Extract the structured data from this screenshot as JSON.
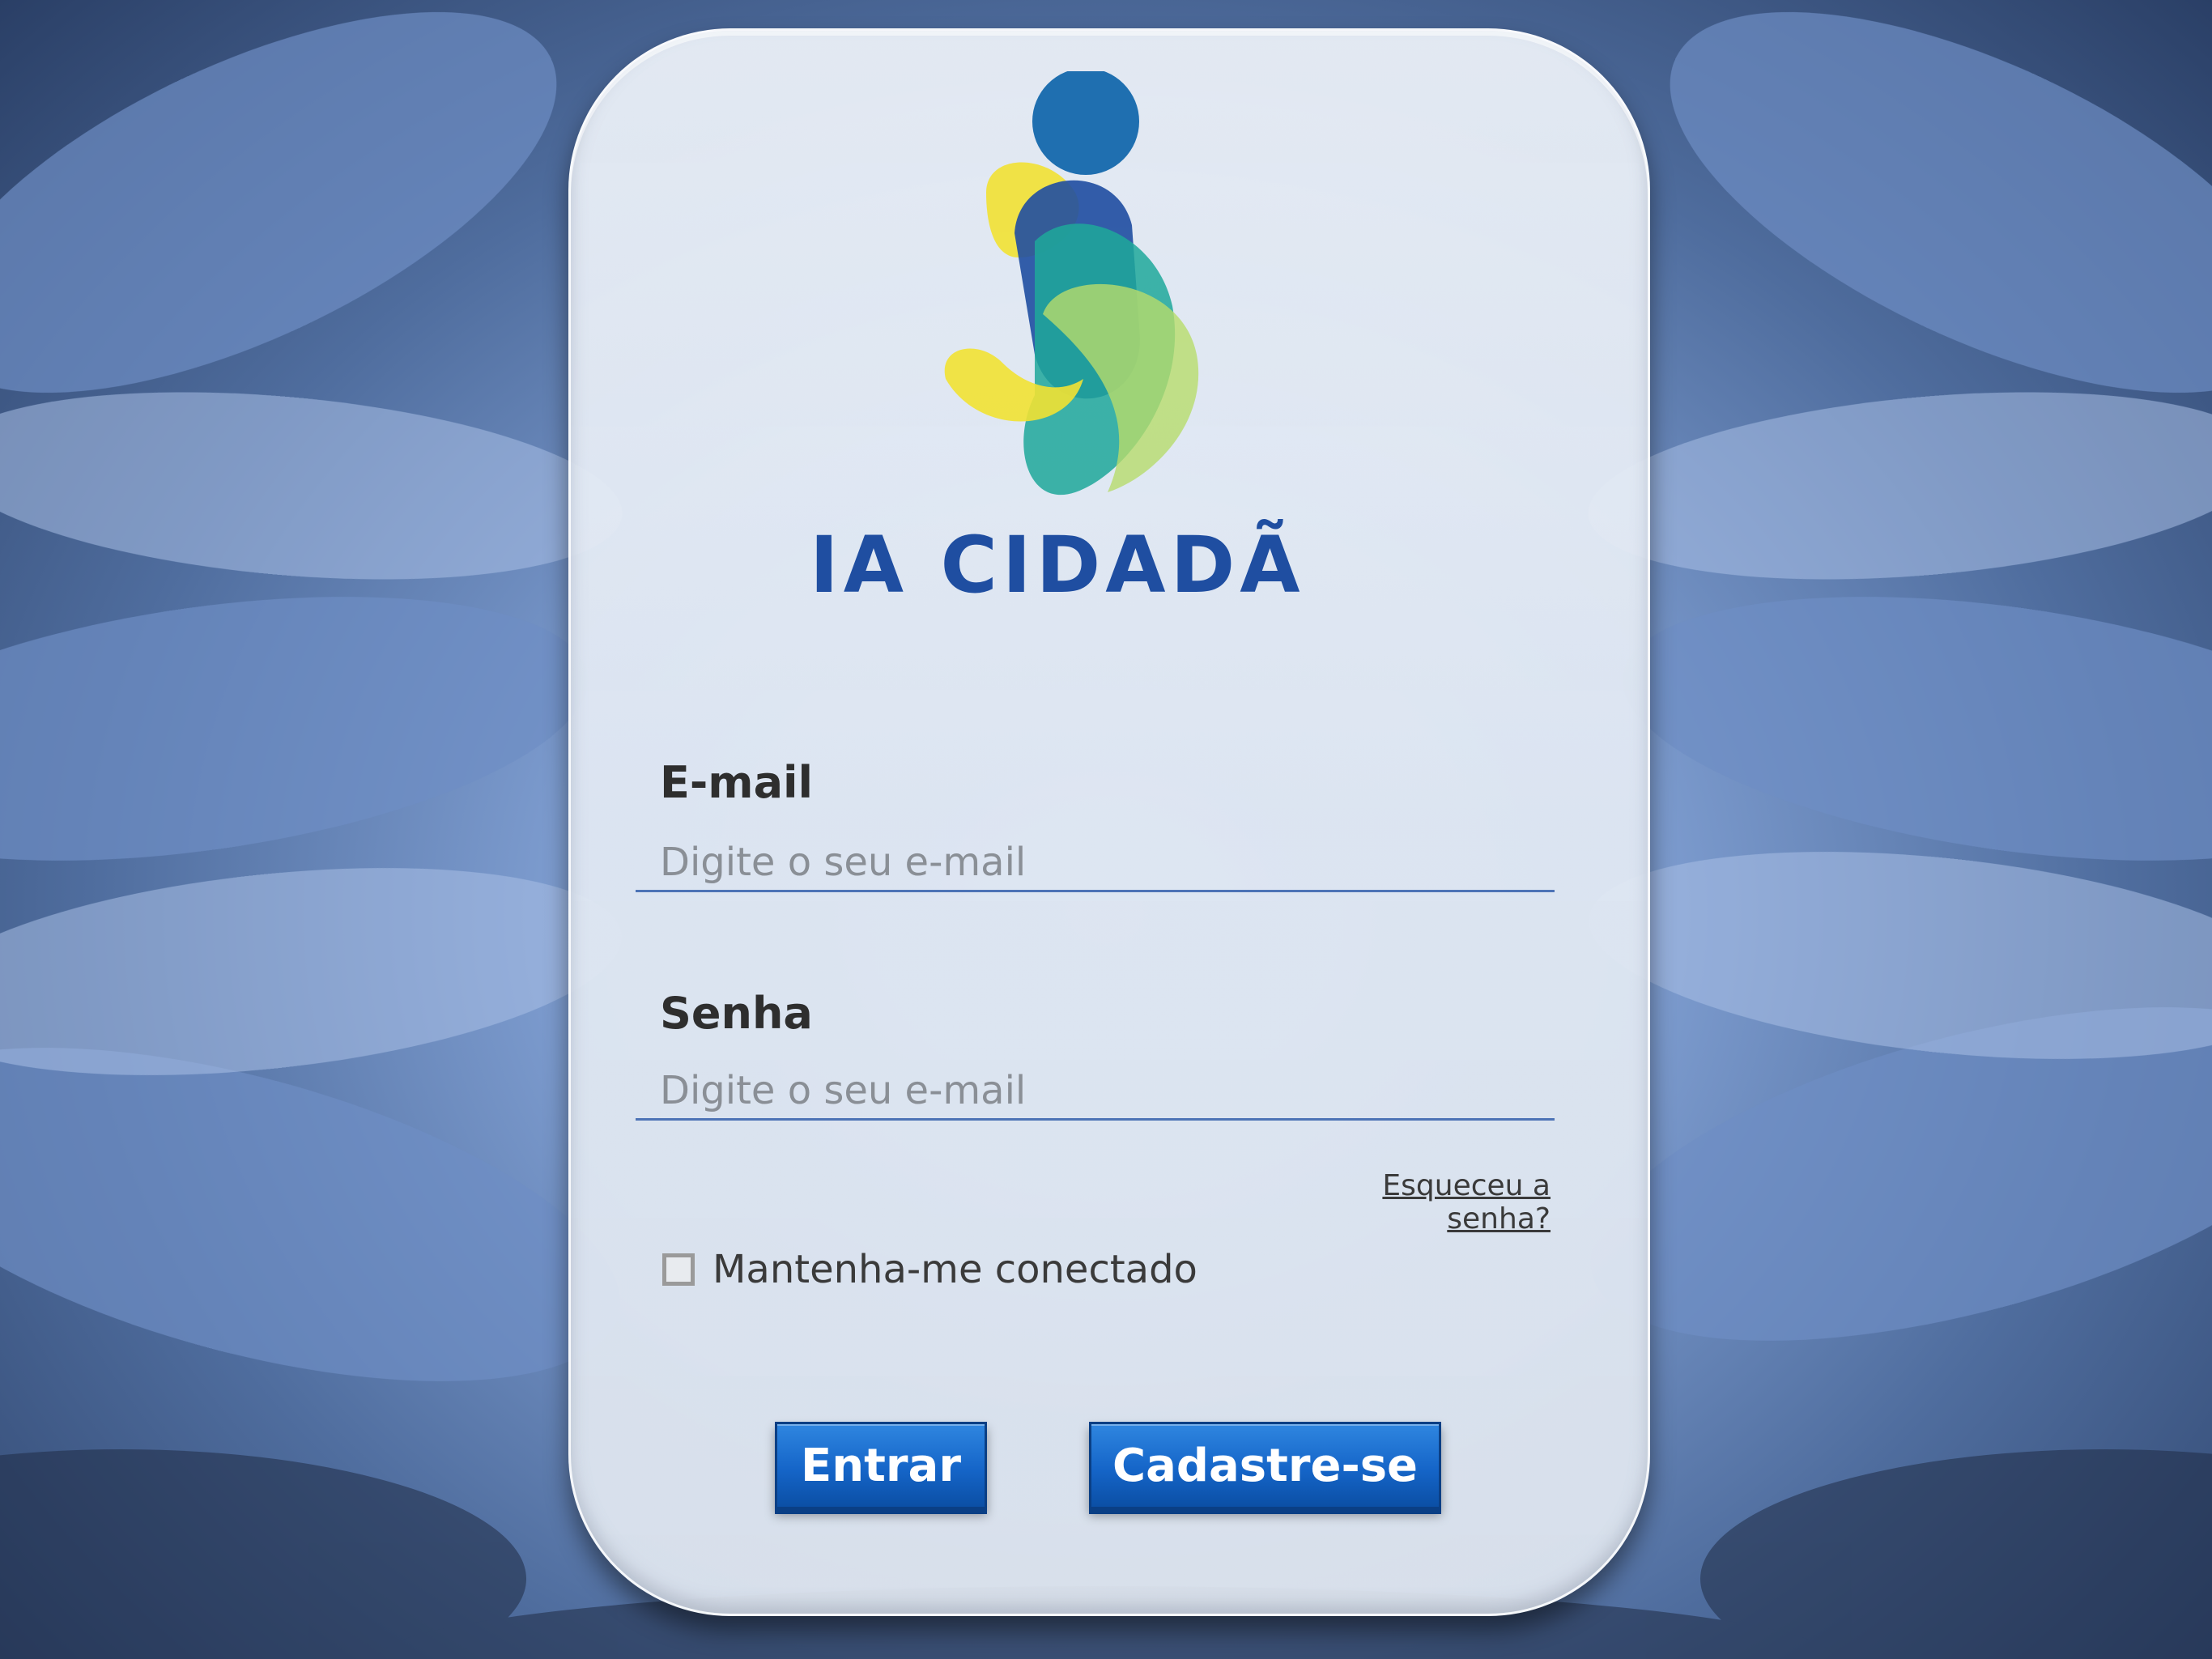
{
  "brand": {
    "name": "IA CIDADÃ",
    "colors": {
      "blue": "#1f4ea1",
      "yellow": "#f2e233",
      "teal": "#1fa89a",
      "green": "#b8dc6b"
    }
  },
  "form": {
    "email": {
      "label": "E-mail",
      "placeholder": "Digite o seu e-mail"
    },
    "password": {
      "label": "Senha",
      "placeholder": "Digite o seu e-mail"
    },
    "forgot_link": "Esqueceu a senha?",
    "remember_label": "Mantenha-me conectado",
    "remember_checked": false
  },
  "buttons": {
    "enter": "Entrar",
    "register": "Cadastre-se",
    "color": "#1565c8"
  }
}
